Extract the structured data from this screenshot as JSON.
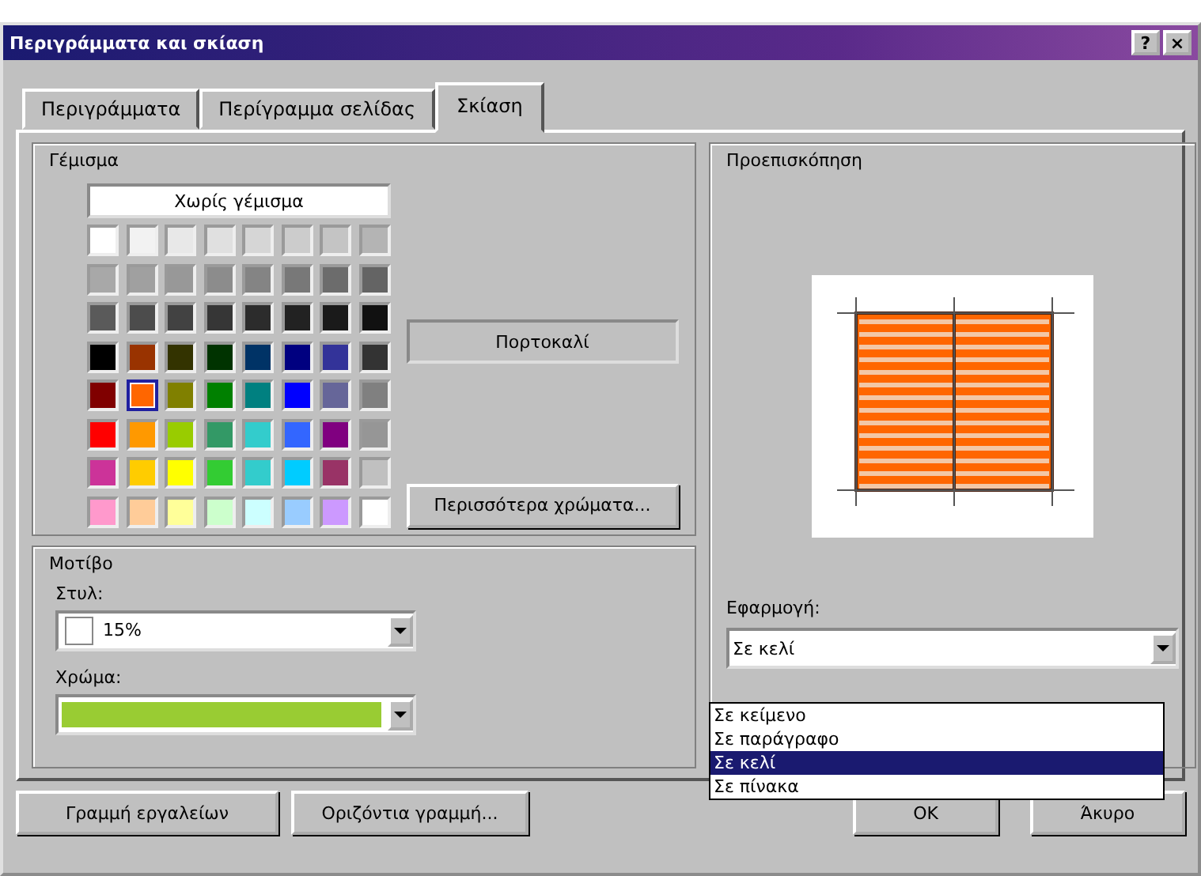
{
  "window": {
    "title": "Περιγράμματα και σκίαση",
    "buttons": [
      "?",
      "×"
    ]
  },
  "tabs": [
    {
      "label": "Περιγράμματα",
      "selected": false
    },
    {
      "label": "Περίγραμμα σελίδας",
      "selected": false
    },
    {
      "label": "Σκίαση",
      "selected": true
    }
  ],
  "fill": {
    "title": "Γέμισμα",
    "no_fill": "Χωρίς γέμισμα",
    "color_name": "Πορτοκαλί",
    "more_colors": "Περισσότερα χρώματα...",
    "swatches": [
      [
        {
          "color": "#ffffff",
          "selected": false
        },
        {
          "color": "#f2f2f2",
          "selected": false
        },
        {
          "color": "#e8e8e8",
          "selected": false
        },
        {
          "color": "#e0e0e0",
          "selected": false
        },
        {
          "color": "#d6d6d6",
          "selected": false
        },
        {
          "color": "#cccccc",
          "selected": false
        },
        {
          "color": "#c4c4c4",
          "selected": false
        },
        {
          "color": "#b4b4b4",
          "selected": false
        }
      ],
      [
        {
          "color": "#a8a8a8",
          "selected": false
        },
        {
          "color": "#a0a0a0",
          "selected": false
        },
        {
          "color": "#989898",
          "selected": false
        },
        {
          "color": "#8c8c8c",
          "selected": false
        },
        {
          "color": "#848484",
          "selected": false
        },
        {
          "color": "#787878",
          "selected": false
        },
        {
          "color": "#6c6c6c",
          "selected": false
        },
        {
          "color": "#646464",
          "selected": false
        }
      ],
      [
        {
          "color": "#5a5a5a",
          "selected": false
        },
        {
          "color": "#4c4c4c",
          "selected": false
        },
        {
          "color": "#424242",
          "selected": false
        },
        {
          "color": "#363636",
          "selected": false
        },
        {
          "color": "#2c2c2c",
          "selected": false
        },
        {
          "color": "#222222",
          "selected": false
        },
        {
          "color": "#1a1a1a",
          "selected": false
        },
        {
          "color": "#111111",
          "selected": false
        }
      ],
      [
        {
          "color": "#000000",
          "selected": false
        },
        {
          "color": "#993300",
          "selected": false
        },
        {
          "color": "#333300",
          "selected": false
        },
        {
          "color": "#003300",
          "selected": false
        },
        {
          "color": "#003366",
          "selected": false
        },
        {
          "color": "#000080",
          "selected": false
        },
        {
          "color": "#333399",
          "selected": false
        },
        {
          "color": "#333333",
          "selected": false
        }
      ],
      [
        {
          "color": "#800000",
          "selected": false
        },
        {
          "color": "#ff6600",
          "selected": true
        },
        {
          "color": "#808000",
          "selected": false
        },
        {
          "color": "#008000",
          "selected": false
        },
        {
          "color": "#008080",
          "selected": false
        },
        {
          "color": "#0000ff",
          "selected": false
        },
        {
          "color": "#666699",
          "selected": false
        },
        {
          "color": "#808080",
          "selected": false
        }
      ],
      [
        {
          "color": "#ff0000",
          "selected": false
        },
        {
          "color": "#ff9900",
          "selected": false
        },
        {
          "color": "#99cc00",
          "selected": false
        },
        {
          "color": "#339966",
          "selected": false
        },
        {
          "color": "#33cccc",
          "selected": false
        },
        {
          "color": "#3366ff",
          "selected": false
        },
        {
          "color": "#800080",
          "selected": false
        },
        {
          "color": "#969696",
          "selected": false
        }
      ],
      [
        {
          "color": "#cc3399",
          "selected": false
        },
        {
          "color": "#ffcc00",
          "selected": false
        },
        {
          "color": "#ffff00",
          "selected": false
        },
        {
          "color": "#33cc33",
          "selected": false
        },
        {
          "color": "#33cccc",
          "selected": false
        },
        {
          "color": "#00ccff",
          "selected": false
        },
        {
          "color": "#993366",
          "selected": false
        },
        {
          "color": "#c0c0c0",
          "selected": false
        }
      ],
      [
        {
          "color": "#ff99cc",
          "selected": false
        },
        {
          "color": "#ffcc99",
          "selected": false
        },
        {
          "color": "#ffff99",
          "selected": false
        },
        {
          "color": "#ccffcc",
          "selected": false
        },
        {
          "color": "#ccffff",
          "selected": false
        },
        {
          "color": "#99ccff",
          "selected": false
        },
        {
          "color": "#cc99ff",
          "selected": false
        },
        {
          "color": "#ffffff",
          "selected": false
        }
      ]
    ]
  },
  "pattern": {
    "title": "Μοτίβο",
    "style_label": "Στυλ:",
    "style_value": "15%",
    "color_label": "Χρώμα:",
    "color": "#99cc33"
  },
  "preview": {
    "title": "Προεπισκόπηση"
  },
  "apply": {
    "label": "Εφαρμογή:",
    "value": "Σε κελί",
    "options": [
      {
        "label": "Σε κείμενο",
        "selected": false
      },
      {
        "label": "Σε παράγραφο",
        "selected": false
      },
      {
        "label": "Σε κελί",
        "selected": true
      },
      {
        "label": "Σε πίνακα",
        "selected": false
      }
    ]
  },
  "left_buttons": [
    "Γραμμή εργαλείων",
    "Οριζόντια γραμμή..."
  ],
  "right_buttons": [
    "OK",
    "Άκυρο"
  ]
}
